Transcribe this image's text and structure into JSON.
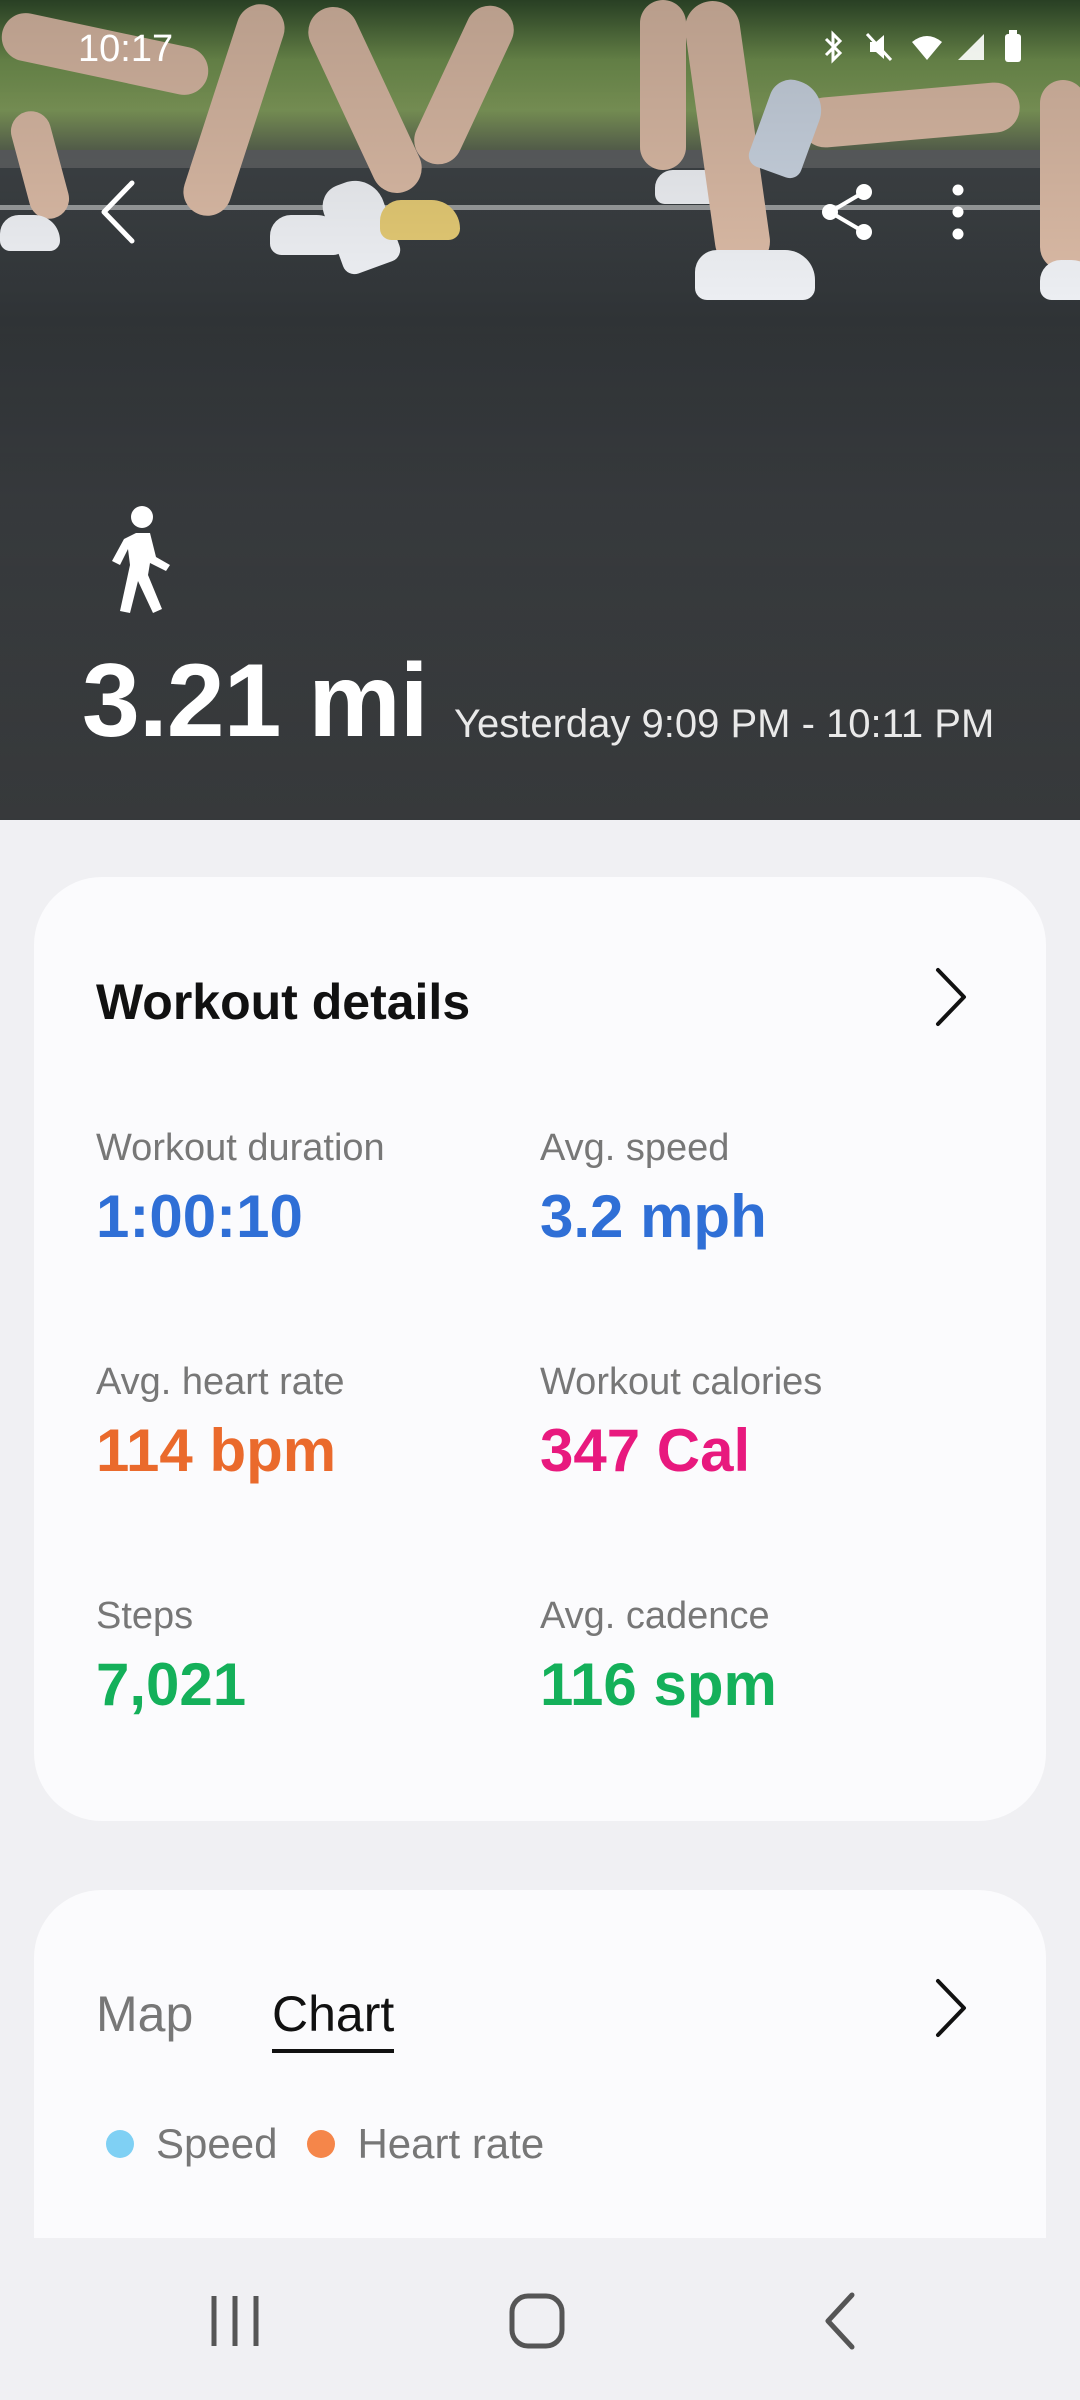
{
  "status_bar": {
    "time": "10:17"
  },
  "header": {
    "back_icon": "back-arrow-icon",
    "share_icon": "share-icon",
    "more_icon": "more-vert-icon"
  },
  "hero": {
    "activity_icon": "walking-icon",
    "distance": "3.21 mi",
    "time_range": "Yesterday 9:09 PM - 10:11 PM"
  },
  "workout_details": {
    "title": "Workout details",
    "metrics": [
      {
        "label": "Workout duration",
        "value": "1:00:10",
        "color": "#2f6fd6"
      },
      {
        "label": "Avg. speed",
        "value": "3.2 mph",
        "color": "#2f6fd6"
      },
      {
        "label": "Avg. heart rate",
        "value": "114 bpm",
        "color": "#ea6a2c"
      },
      {
        "label": "Workout calories",
        "value": "347 Cal",
        "color": "#e8197e"
      },
      {
        "label": "Steps",
        "value": "7,021",
        "color": "#14b05a"
      },
      {
        "label": "Avg. cadence",
        "value": "116 spm",
        "color": "#14b05a"
      }
    ]
  },
  "map_chart": {
    "tabs": [
      {
        "label": "Map",
        "selected": false
      },
      {
        "label": "Chart",
        "selected": true
      }
    ],
    "legend": [
      {
        "label": "Speed",
        "color": "#7fd0f4"
      },
      {
        "label": "Heart rate",
        "color": "#f5864a"
      }
    ]
  },
  "nav": {
    "recents_icon": "recents-icon",
    "home_icon": "home-icon",
    "back_icon": "nav-back-icon"
  }
}
